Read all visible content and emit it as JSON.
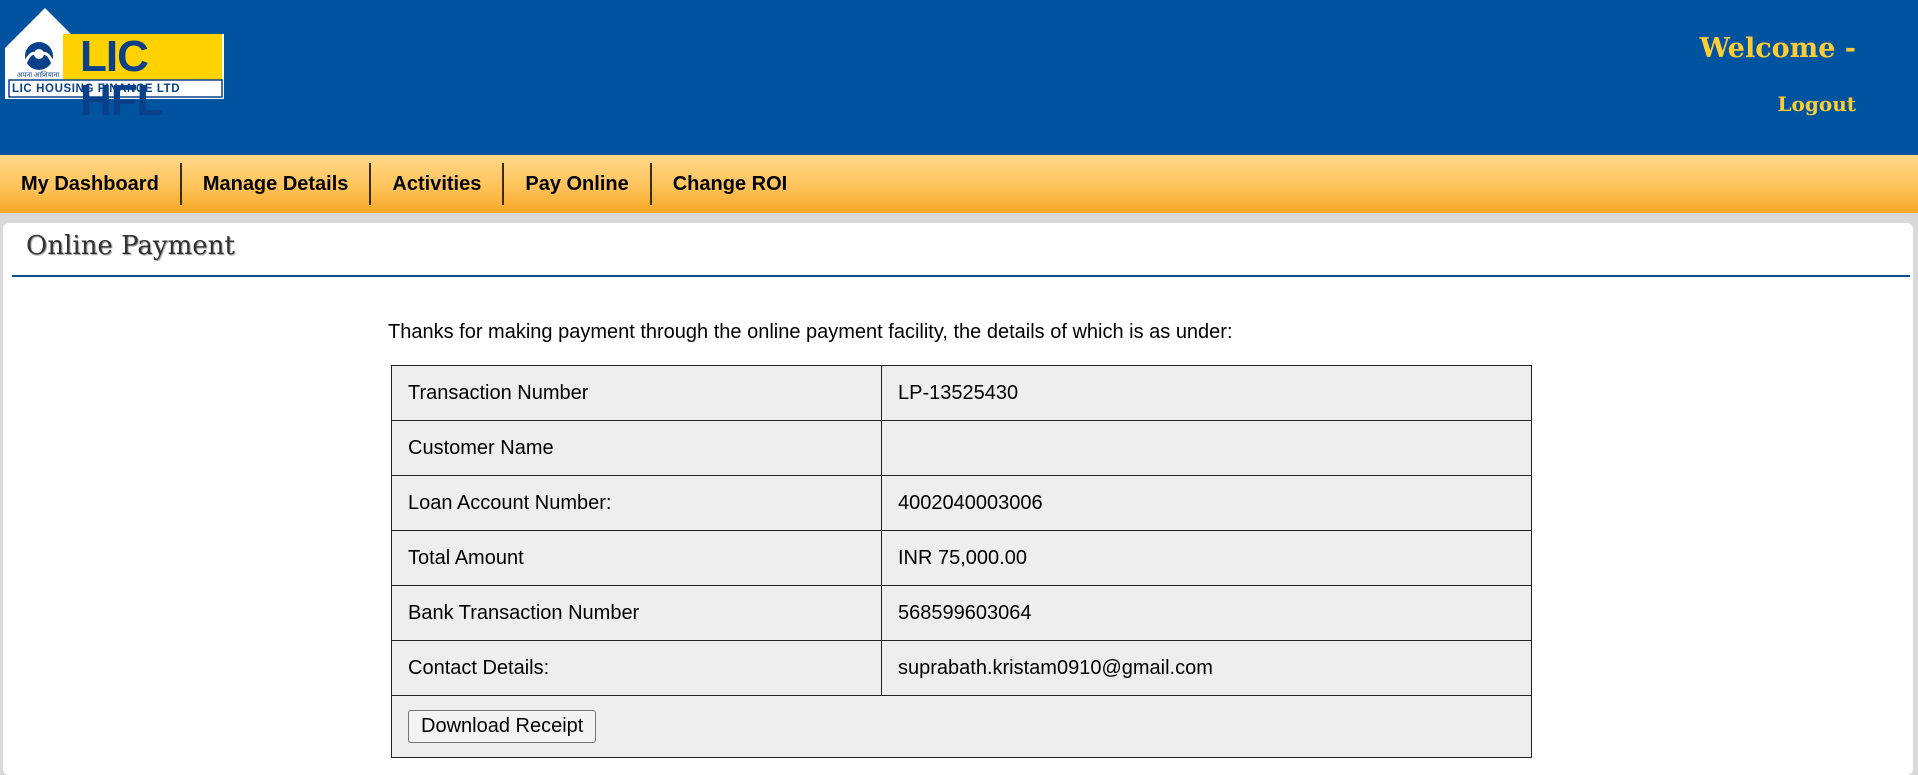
{
  "header": {
    "logo_text": "LIC HFL",
    "logo_subtitle": "LIC HOUSING FINANCE LTD",
    "welcome": "Welcome -",
    "logout": "Logout"
  },
  "nav": {
    "items": [
      "My Dashboard",
      "Manage Details",
      "Activities",
      "Pay Online",
      "Change ROI"
    ]
  },
  "page": {
    "title": "Online Payment",
    "intro": "Thanks for making payment through the online payment facility, the details of which is as under:"
  },
  "details": {
    "rows": [
      {
        "label": "Transaction Number",
        "value": "LP-13525430"
      },
      {
        "label": "Customer Name",
        "value": ""
      },
      {
        "label": "Loan Account Number:",
        "value": "4002040003006"
      },
      {
        "label": "Total Amount",
        "value": "INR 75,000.00"
      },
      {
        "label": "Bank Transaction Number",
        "value": "568599603064"
      },
      {
        "label": "Contact Details:",
        "value": "suprabath.kristam0910@gmail.com"
      }
    ],
    "download_button": "Download Receipt"
  },
  "colors": {
    "header_blue": "#00539e",
    "accent_yellow": "#ffcc33",
    "nav_orange": "#ffc35a"
  }
}
